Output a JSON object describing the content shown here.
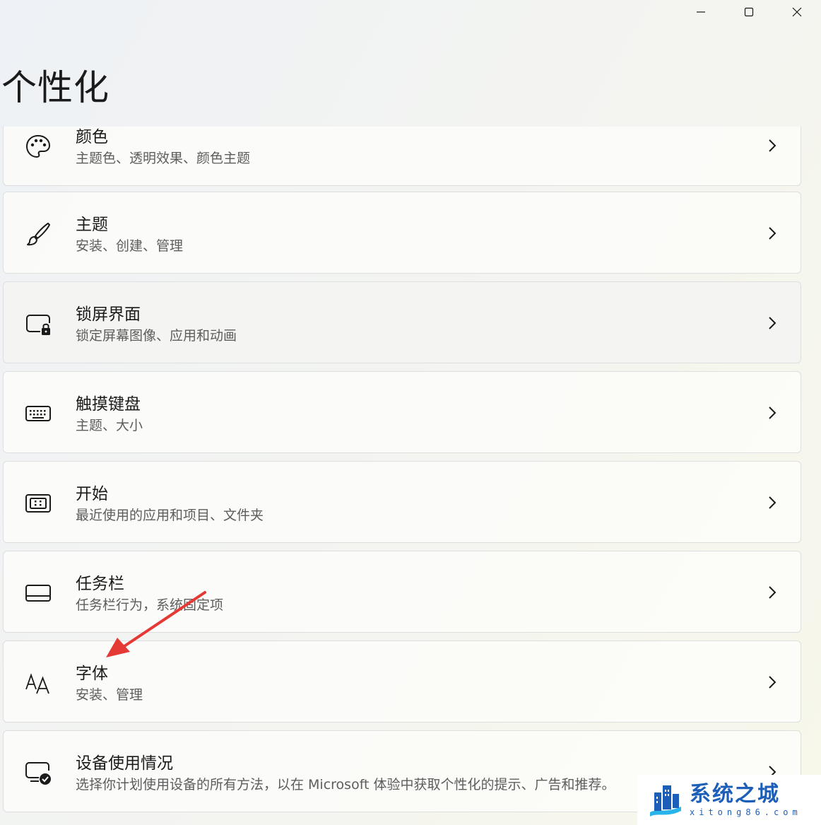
{
  "page": {
    "title": "个性化"
  },
  "window": {
    "minimize_icon": "minimize-icon",
    "maximize_icon": "maximize-icon",
    "close_icon": "close-icon"
  },
  "items": [
    {
      "title": "颜色",
      "subtitle": "主题色、透明效果、颜色主题",
      "icon": "palette-icon"
    },
    {
      "title": "主题",
      "subtitle": "安装、创建、管理",
      "icon": "brush-icon"
    },
    {
      "title": "锁屏界面",
      "subtitle": "锁定屏幕图像、应用和动画",
      "icon": "lock-screen-icon"
    },
    {
      "title": "触摸键盘",
      "subtitle": "主题、大小",
      "icon": "keyboard-icon"
    },
    {
      "title": "开始",
      "subtitle": "最近使用的应用和项目、文件夹",
      "icon": "start-icon"
    },
    {
      "title": "任务栏",
      "subtitle": "任务栏行为，系统固定项",
      "icon": "taskbar-icon"
    },
    {
      "title": "字体",
      "subtitle": "安装、管理",
      "icon": "font-icon"
    },
    {
      "title": "设备使用情况",
      "subtitle": "选择你计划使用设备的所有方法，以在 Microsoft 体验中获取个性化的提示、广告和推荐。",
      "icon": "device-usage-icon"
    }
  ],
  "annotation": {
    "arrow_color": "#e53935"
  },
  "watermark": {
    "name": "系统之城",
    "domain": "xitong86.com"
  },
  "colors": {
    "card_background": "#fbfbf9",
    "card_border": "#dedede",
    "secondary_text": "#5d5d5d",
    "watermark_blue": "#1d5fb8"
  }
}
